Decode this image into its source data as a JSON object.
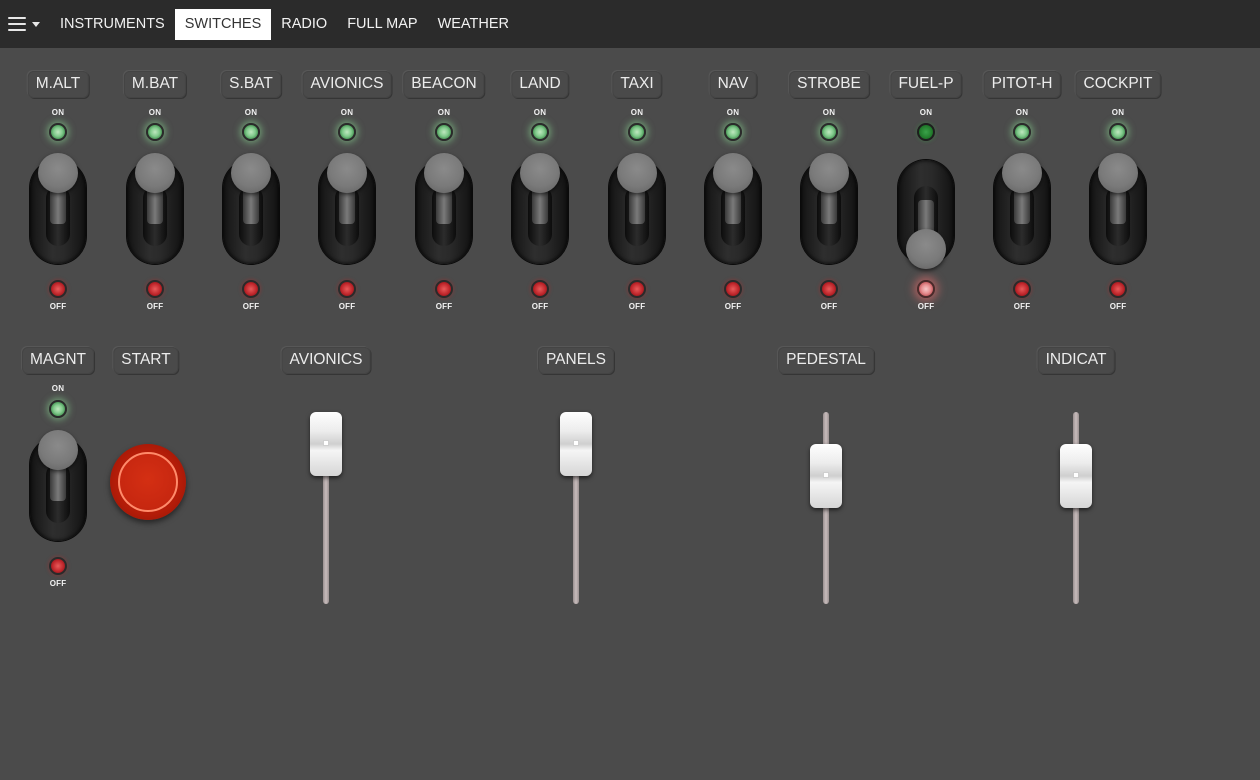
{
  "nav": {
    "menu_icon": "hamburger-icon",
    "tabs": [
      {
        "label": "INSTRUMENTS",
        "active": false
      },
      {
        "label": "SWITCHES",
        "active": true
      },
      {
        "label": "RADIO",
        "active": false
      },
      {
        "label": "FULL MAP",
        "active": false
      },
      {
        "label": "WEATHER",
        "active": false
      }
    ]
  },
  "switch_states": {
    "on_label": "ON",
    "off_label": "OFF"
  },
  "toggles": [
    {
      "label": "M.ALT",
      "state": "on"
    },
    {
      "label": "M.BAT",
      "state": "on"
    },
    {
      "label": "S.BAT",
      "state": "on"
    },
    {
      "label": "AVIONICS",
      "state": "on"
    },
    {
      "label": "BEACON",
      "state": "on"
    },
    {
      "label": "LAND",
      "state": "on"
    },
    {
      "label": "TAXI",
      "state": "on"
    },
    {
      "label": "NAV",
      "state": "on"
    },
    {
      "label": "STROBE",
      "state": "on"
    },
    {
      "label": "FUEL-P",
      "state": "off"
    },
    {
      "label": "PITOT-H",
      "state": "on"
    },
    {
      "label": "COCKPIT",
      "state": "on"
    }
  ],
  "magneto": {
    "label": "MAGNT",
    "state": "on"
  },
  "start": {
    "label": "START"
  },
  "dimmers": [
    {
      "label": "AVIONICS",
      "level": 1.0
    },
    {
      "label": "PANELS",
      "level": 1.0
    },
    {
      "label": "PEDESTAL",
      "level": 0.75
    },
    {
      "label": "INDICAT",
      "level": 0.75
    }
  ],
  "colors": {
    "background": "#4b4b4b",
    "topbar": "#2b2b2b",
    "led_on": "#7fc98a",
    "led_off": "#c0262b",
    "start_button": "#c72710"
  }
}
